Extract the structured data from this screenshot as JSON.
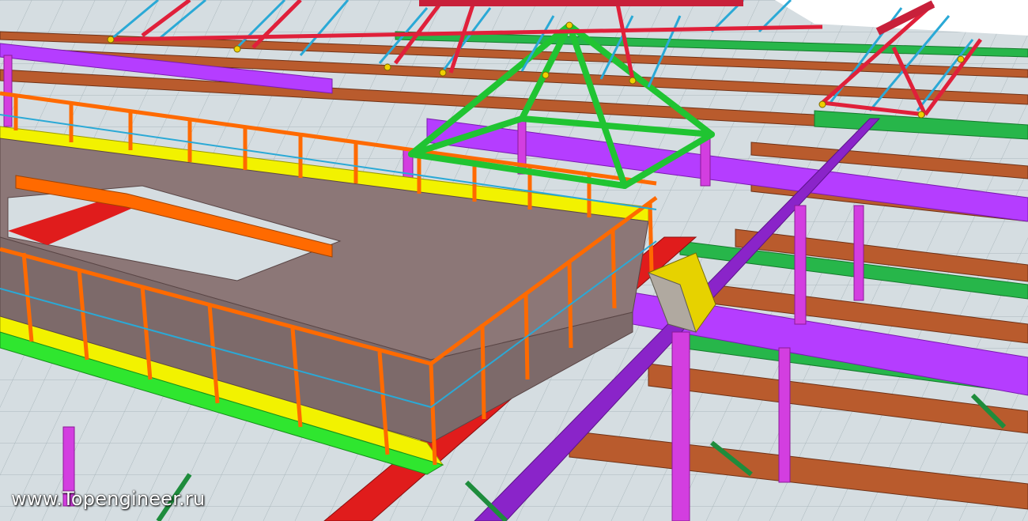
{
  "watermark": {
    "text": "www.Topengineer.ru"
  },
  "colors": {
    "sky": "#ffffff",
    "ground": "#d7dfe3",
    "grid_line": "#9aa8ae",
    "brown_beam": "#b85a2c",
    "brown_dark": "#7e3a1a",
    "magenta": "#b43cff",
    "magenta_dark": "#8a22c8",
    "green": "#28b84a",
    "bright_green": "#32e632",
    "red": "#e21d1d",
    "blue_truss": "#2aa9d6",
    "orange": "#ff6a00",
    "yellow": "#f0f000",
    "platform": "#8c7878",
    "pink_column": "#e040e8"
  },
  "icons": [
    "steel-structure-render",
    "roof-truss",
    "platform-deck",
    "staircase"
  ]
}
